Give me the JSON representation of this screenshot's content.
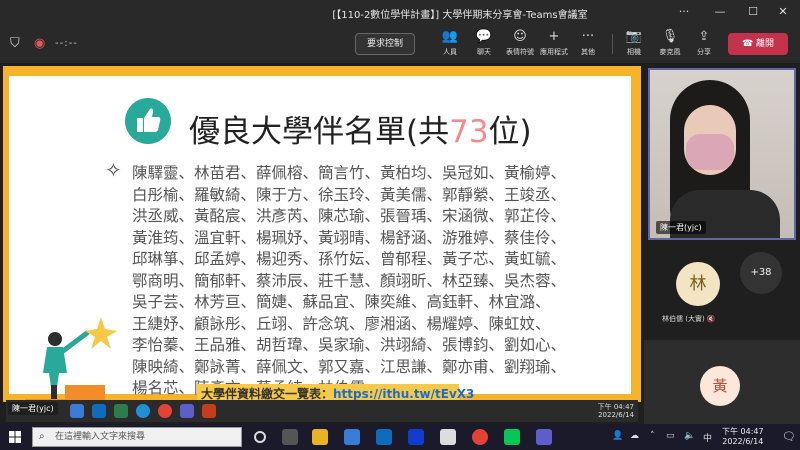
{
  "window": {
    "title": "[【110-2數位學伴計畫】] 大學伴期末分享會-Teams會議室",
    "minimize": "—",
    "maximize": "☐",
    "close": "✕"
  },
  "meeting_bar": {
    "timer": "--:--",
    "control_button": "要求控制",
    "tools": [
      {
        "icon": "people-icon",
        "glyph": "👥",
        "label": "人員"
      },
      {
        "icon": "chat-icon",
        "glyph": "💬",
        "label": "聊天"
      },
      {
        "icon": "reaction-icon",
        "glyph": "☺",
        "label": "表情符號"
      },
      {
        "icon": "apps-icon",
        "glyph": "+",
        "label": "應用程式"
      },
      {
        "icon": "more-icon",
        "glyph": "···",
        "label": "其他"
      },
      {
        "icon": "camera-icon",
        "glyph": "📷",
        "label": "相機"
      },
      {
        "icon": "mic-icon",
        "glyph": "🎙",
        "label": "麥克風"
      },
      {
        "icon": "share-icon",
        "glyph": "⇪",
        "label": "分享"
      }
    ],
    "leave_button": "離開"
  },
  "slide": {
    "title_prefix": "優良大學伴名單(共",
    "title_number": "73",
    "title_suffix": "位)",
    "name_lines": [
      "陳驛靈、林苗君、薛佩榕、簡言竹、黃柏均、吳冠如、黃榆婷、",
      "白彤榆、羅敏綺、陳于方、徐玉玲、黃美儒、郭靜縈、王竣丞、",
      "洪丞威、黃酩宸、洪彥芮、陳芯瑜、張晉瑀、宋涵微、郭芷伶、",
      "黃淮筠、溫宜軒、楊珮妤、黃翊晴、楊舒涵、游雅婷、蔡佳伶、",
      "邱琳箏、邱孟婷、楊迎秀、孫竹妘、曾郁程、黃子芯、黃虹毓、",
      "鄂商明、簡郁軒、蔡沛辰、莊千慧、顏翊昕、林亞臻、吳杰蓉、",
      "吳子芸、林芳亘、簡婕、蘇品宜、陳奕維、高鈺軒、林宜潞、",
      "王緁妤、顧詠彤、丘翊、許念筑、廖湘涵、楊耀婷、陳虹妏、",
      "李怡蓁、王品雅、胡哲瑋、吳家瑜、洪翊綺、張博鈞、劉如心、",
      "陳映綺、鄭詠菁、薛佩文、郭又嘉、江思謙、鄭亦甫、劉翔瑜、",
      "楊名芯、陳彥文、蔡孟純、林伯儒"
    ],
    "link_label": "大學伴資料繳交一覽表：",
    "link_url": "https://ithu.tw/tEvX3"
  },
  "presenter": {
    "label": "陳一君(yjc)",
    "taskbar_time": "下午 04:47",
    "taskbar_date": "2022/6/14"
  },
  "participants": {
    "video_name": "陳一君(yjc)",
    "tile1_avatar": "林",
    "tile1_name": "林伯儒 (大實)",
    "more_count": "+38",
    "tile3_avatar": "黃"
  },
  "taskbar": {
    "search_placeholder": "在這裡輸入文字來搜尋",
    "ime": "中",
    "time": "下午 04:47",
    "date": "2022/6/14"
  },
  "colors": {
    "slide_border": "#f7b32b",
    "accent_title_number": "#f08c8c",
    "leave_red": "#c4314b",
    "teams_purple": "#6264a7"
  }
}
